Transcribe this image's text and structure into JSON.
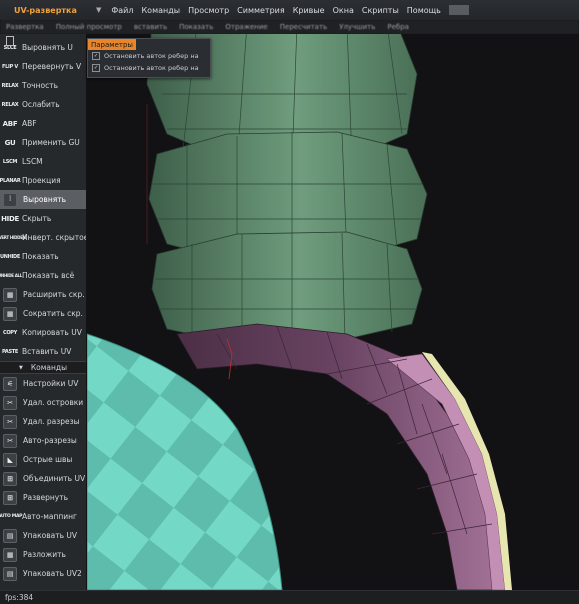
{
  "app": {
    "title": "UV-развертка"
  },
  "menu": [
    "Файл",
    "Команды",
    "Просмотр",
    "Симметрия",
    "Кривые",
    "Окна",
    "Скрипты",
    "Помощь"
  ],
  "toolbar2": [
    "Развертка",
    "Полный просмотр",
    "вставить",
    "Показать",
    "Отражение",
    "Пересчитать",
    "Улучшить",
    "Ребра"
  ],
  "popup": {
    "title": "Параметры",
    "options": [
      "Остановить авток ребер на",
      "Остановить авток ребер на"
    ]
  },
  "tools": [
    {
      "icon": "SLCE",
      "label": "Выровнять U"
    },
    {
      "icon": "FLIP V",
      "label": "Перевернуть V"
    },
    {
      "icon": "RELAX",
      "label": "Точность"
    },
    {
      "icon": "RELAX",
      "label": "Ослабить"
    },
    {
      "icon": "ABF",
      "label": "ABF"
    },
    {
      "icon": "GU",
      "label": "Применить GU"
    },
    {
      "icon": "LSCM",
      "label": "LSCM"
    },
    {
      "icon": "PLANAR",
      "label": "Проекция"
    },
    {
      "icon": "⫶",
      "label": "Выровнять"
    },
    {
      "icon": "HIDE",
      "label": "Скрыть"
    },
    {
      "icon": "INVERT HIDDEN",
      "label": "Инверт. скрытое"
    },
    {
      "icon": "UNHIDE",
      "label": "Показать"
    },
    {
      "icon": "UNHIDE ALL",
      "label": "Показать всё"
    },
    {
      "icon": "▦",
      "label": "Расширить скр."
    },
    {
      "icon": "▦",
      "label": "Сократить скр."
    },
    {
      "icon": "COPY",
      "label": "Копировать UV"
    },
    {
      "icon": "PASTE",
      "label": "Вставить UV"
    }
  ],
  "section_label": "Команды",
  "commands": [
    {
      "icon": "⚟",
      "label": "Настройки UV"
    },
    {
      "icon": "✂",
      "label": "Удал. островки"
    },
    {
      "icon": "✂",
      "label": "Удал. разрезы"
    },
    {
      "icon": "✂",
      "label": "Авто-разрезы"
    },
    {
      "icon": "◣",
      "label": "Острые швы"
    },
    {
      "icon": "⊞",
      "label": "Объединить UV"
    },
    {
      "icon": "⊞",
      "label": "Развернуть"
    },
    {
      "icon": "AUTO MAP",
      "label": "Авто-маппинг"
    },
    {
      "icon": "▤",
      "label": "Упаковать UV"
    },
    {
      "icon": "▦",
      "label": "Разложить"
    },
    {
      "icon": "▤",
      "label": "Упаковать UV2"
    }
  ],
  "status": {
    "fps": "fps:384"
  },
  "colors": {
    "accent": "#e8842a",
    "green_mesh": "#5e8a6c",
    "pink_mesh": "#c48fb4",
    "cyan_mesh": "#6fd6c3",
    "yellow_edge": "#e7e6b0"
  }
}
